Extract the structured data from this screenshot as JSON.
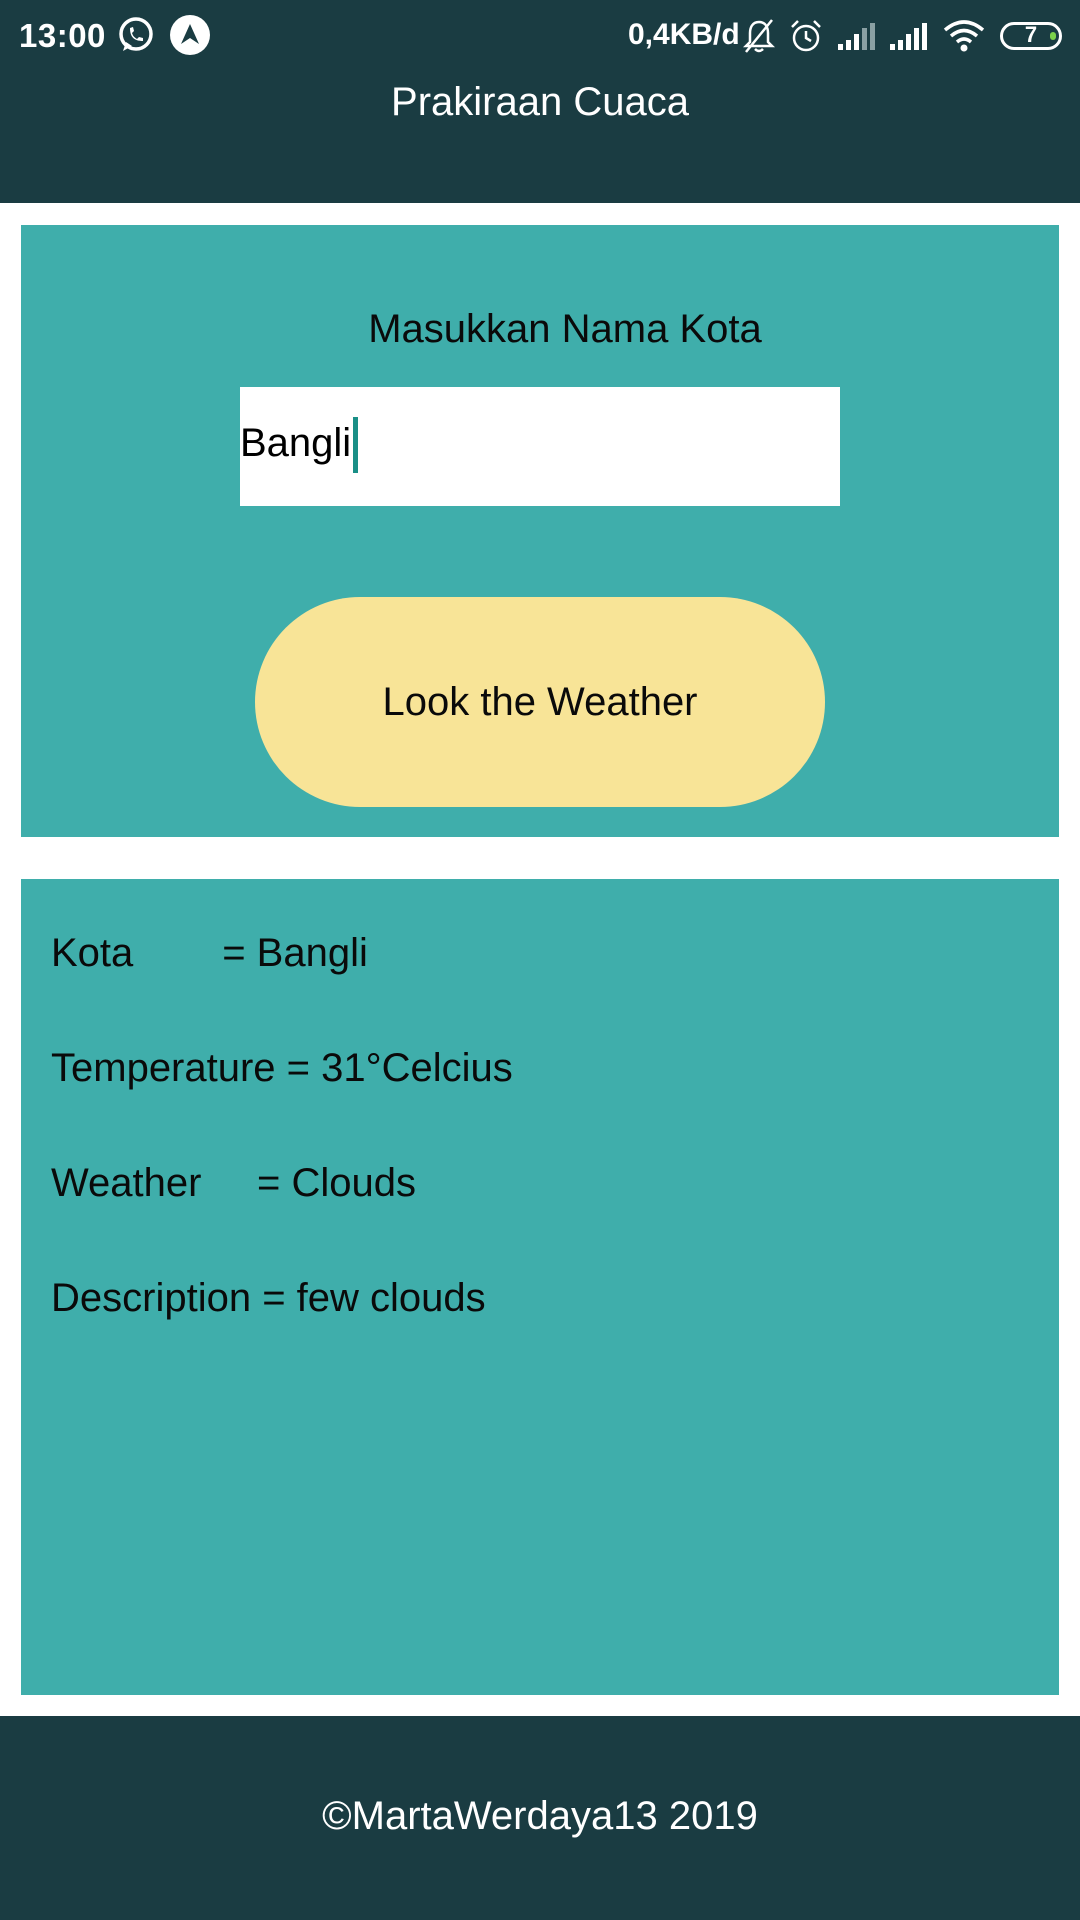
{
  "status_bar": {
    "time": "13:00",
    "net_speed": "0,4KB/d",
    "battery_level": "7",
    "icons": [
      "whatsapp-icon",
      "navigation-icon",
      "mute-icon",
      "alarm-icon",
      "signal-icon",
      "signal-icon",
      "wifi-icon",
      "battery-icon"
    ]
  },
  "header": {
    "title": "Prakiraan Cuaca"
  },
  "search": {
    "label": "Masukkan Nama Kota",
    "value": "Bangli",
    "button_label": "Look the Weather"
  },
  "result": {
    "lines": [
      "Kota        = Bangli",
      "Temperature = 31°Celcius",
      "Weather     = Clouds",
      "Description = few clouds"
    ]
  },
  "footer": {
    "text": "©MartaWerdaya13 2019"
  },
  "colors": {
    "header_bg": "#1a3c42",
    "card_bg": "#3faeab",
    "button_bg": "#f8e497",
    "caret": "#1a8f87"
  }
}
